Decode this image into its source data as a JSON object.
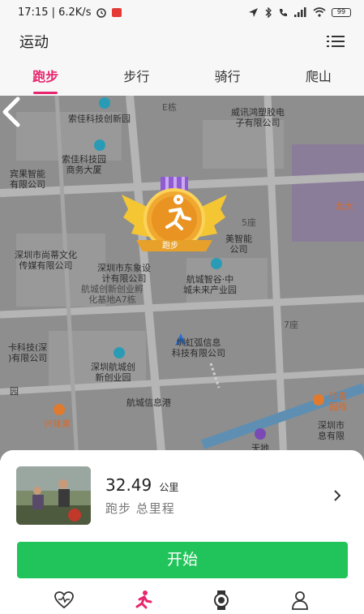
{
  "status_bar": {
    "time_speed": "17:15 | 6.2K/s",
    "battery": "99"
  },
  "header": {
    "title": "运动"
  },
  "tabs": [
    {
      "label": "跑步",
      "active": true
    },
    {
      "label": "步行",
      "active": false
    },
    {
      "label": "骑行",
      "active": false
    },
    {
      "label": "爬山",
      "active": false
    }
  ],
  "map": {
    "labels": {
      "l1": "E栋",
      "l2": "威讯鸿塑胶电\n子有限公司",
      "l3": "索佳科技创新园",
      "l4": "索佳科技园\n商务大厦",
      "l5": "宾果智能\n有限公司",
      "l6": "北大",
      "l7": "5座",
      "l8": "美智能\n公司",
      "l9": "深圳市尚蒂文化\n传媒有限公司",
      "l10": "深圳市东象设\n计有限公司",
      "l11": "航城智谷·中\n城未来产业园",
      "l12": "航城创新创业孵\n化基地A7栋",
      "l13": "7座",
      "l14": "圳虹弧信息\n科技有限公司",
      "l15": "卡科技(深\n)有限公司",
      "l16": "深圳航城创\n新创业园",
      "l17": "园",
      "l18": "航城信息港",
      "l19": "珍香\n园残",
      "l20": "兴味臬",
      "l21": "深圳市\n息有限",
      "l22": "天地"
    },
    "medal_label": "跑步"
  },
  "summary": {
    "distance_value": "32.49",
    "distance_unit": "公里",
    "distance_label": "跑步 总里程"
  },
  "start_button": {
    "label": "开始"
  },
  "colors": {
    "accent": "#e8266f",
    "start_green": "#21c45a",
    "map_bg": "#8f8f8f"
  },
  "bottom_nav": {
    "items": [
      "heart-icon",
      "running-icon",
      "watch-icon",
      "person-icon"
    ]
  }
}
